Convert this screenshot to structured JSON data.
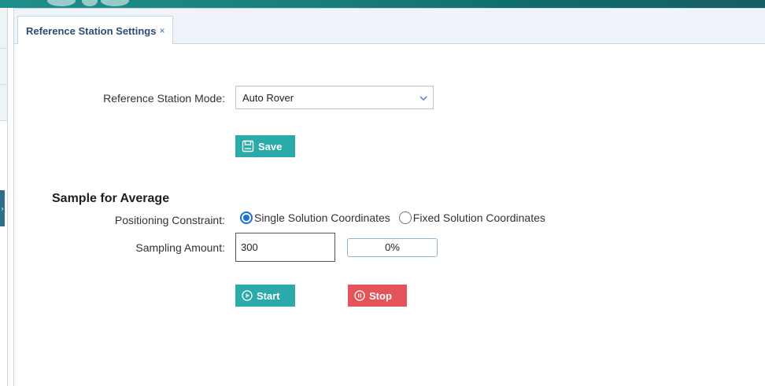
{
  "tabs": [
    {
      "label": "Reference Station Settings",
      "close": "×"
    }
  ],
  "mode": {
    "label": "Reference Station Mode:",
    "value": "Auto Rover"
  },
  "save_button": {
    "label": "Save",
    "icon": "save-icon"
  },
  "sample": {
    "title": "Sample for Average",
    "constraint_label": "Positioning Constraint:",
    "options": [
      {
        "label": "Single Solution Coordinates",
        "checked": true
      },
      {
        "label": "Fixed Solution Coordinates",
        "checked": false
      }
    ],
    "amount_label": "Sampling Amount:",
    "amount_value": "300",
    "progress_text": "0%",
    "progress_fraction": 0
  },
  "start_button": {
    "label": "Start",
    "icon": "play-circle-icon"
  },
  "stop_button": {
    "label": "Stop",
    "icon": "pause-circle-icon"
  },
  "colors": {
    "accent": "#2aabaa",
    "danger": "#e4535a",
    "radio": "#1872d6",
    "tab_text": "#2a4e74"
  }
}
